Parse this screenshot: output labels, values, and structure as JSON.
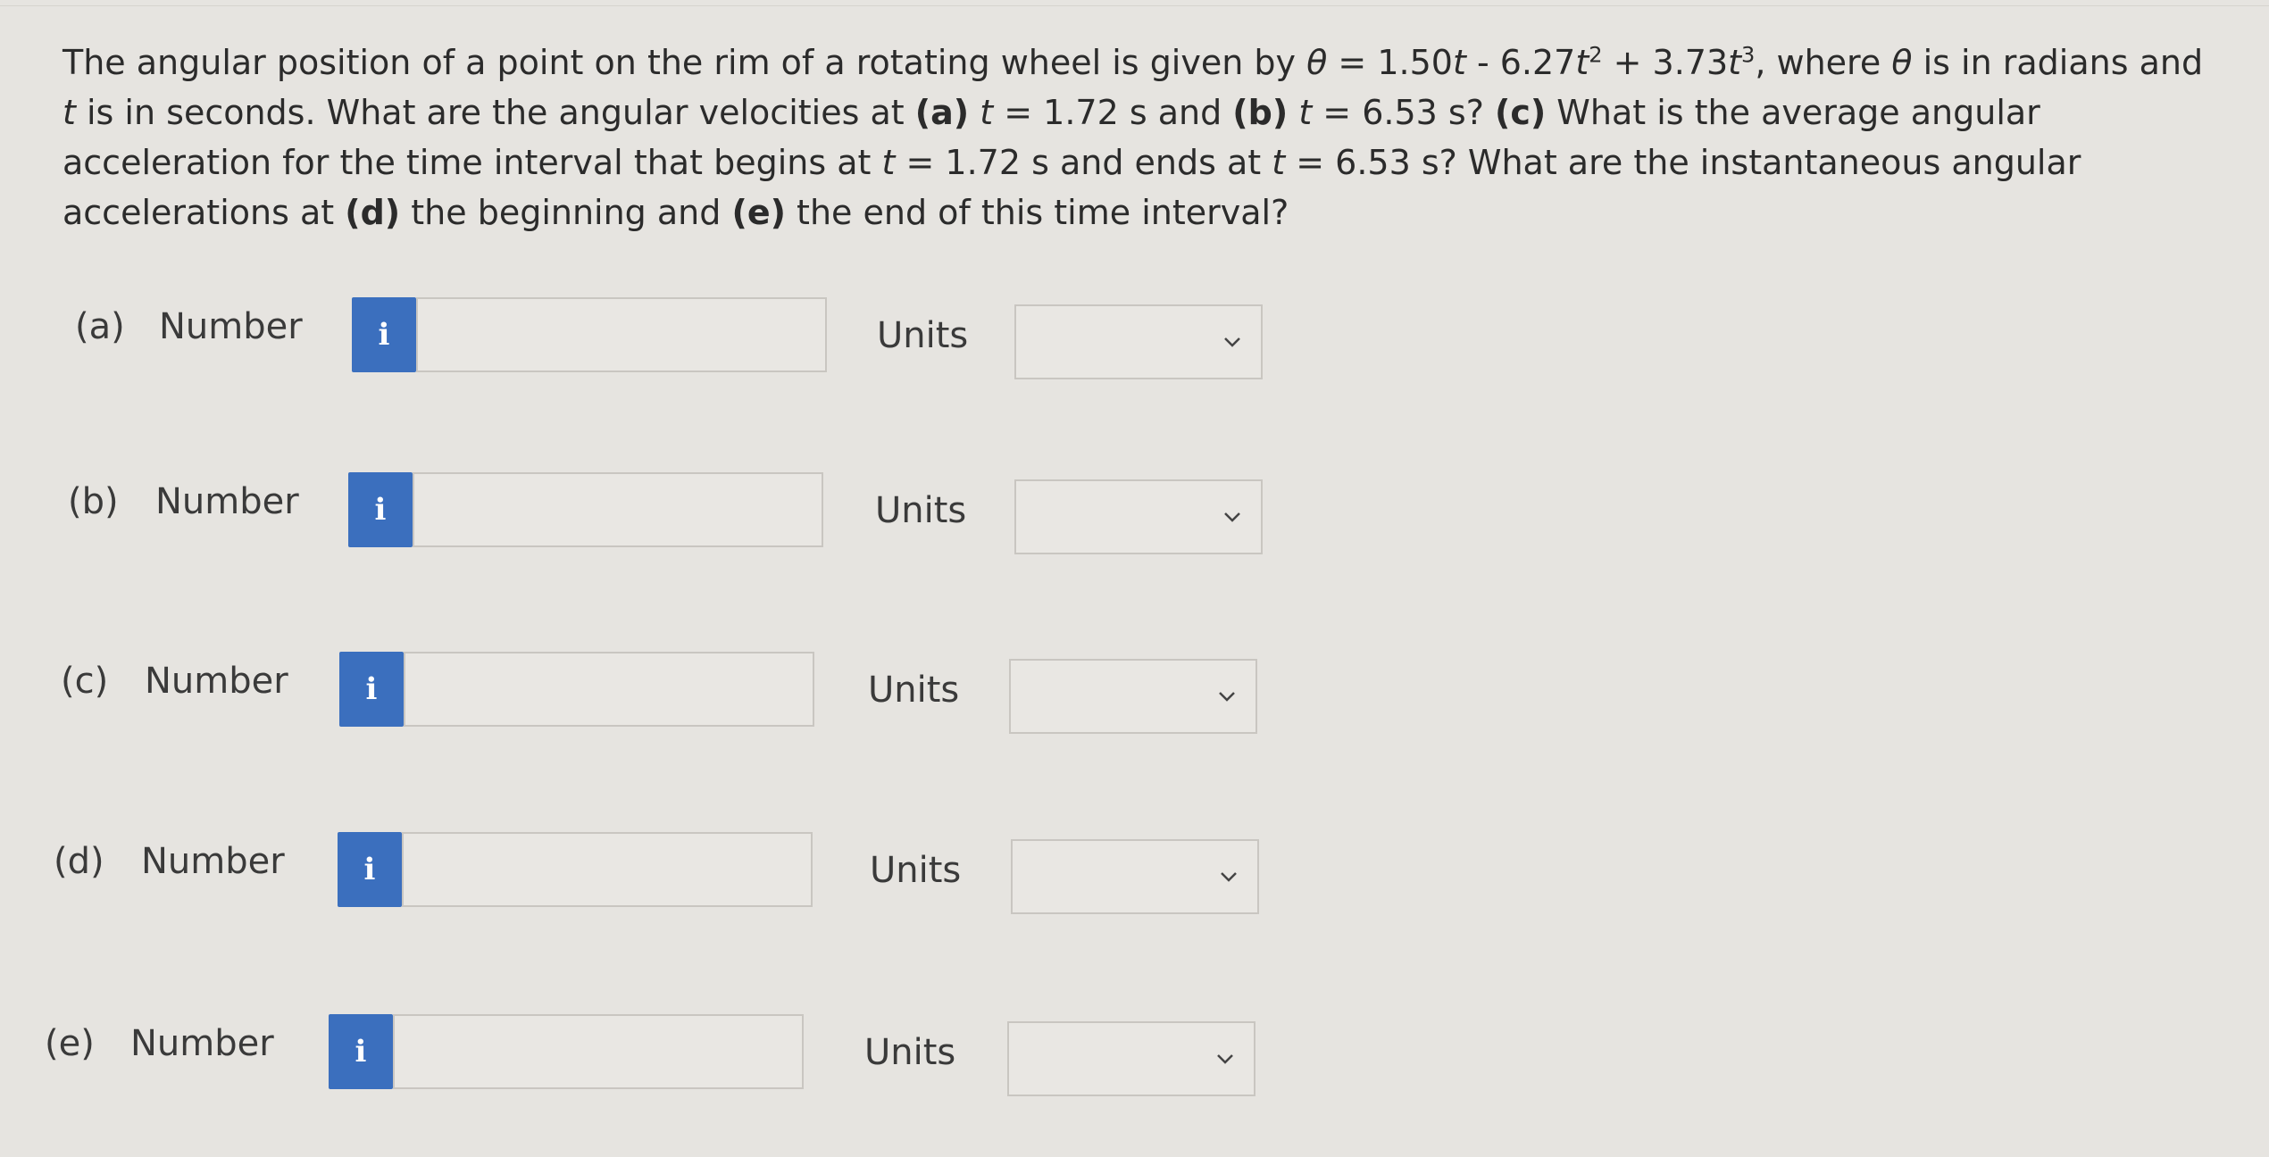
{
  "question": {
    "p1": "The angular position of a point on the rim of a rotating wheel is given by ",
    "theta": "θ",
    "eq1": " = 1.50",
    "t": "t",
    "eq2": " - 6.27",
    "sq": "2",
    "eq3": " + 3.73",
    "cube": "3",
    "p2": ", where ",
    "p3": " is in radians and ",
    "p4": " is in seconds. What are the angular velocities at ",
    "a_tag": "(a)",
    "p5": " = 1.72 s and ",
    "b_tag": "(b)",
    "p6": " = 6.53 s? ",
    "c_tag": "(c)",
    "p7": " What is the average angular acceleration for the time interval that begins at ",
    "p8": " = 1.72 s and ends at ",
    "p9": " = 6.53 s? What are the instantaneous angular accelerations at ",
    "d_tag": "(d)",
    "p10": " the beginning and ",
    "e_tag": "(e)",
    "p11": " the end of this time interval?"
  },
  "parts": [
    {
      "tag": "(a)",
      "number_label": "Number",
      "info": "i",
      "value": "",
      "units_label": "Units",
      "units_value": ""
    },
    {
      "tag": "(b)",
      "number_label": "Number",
      "info": "i",
      "value": "",
      "units_label": "Units",
      "units_value": ""
    },
    {
      "tag": "(c)",
      "number_label": "Number",
      "info": "i",
      "value": "",
      "units_label": "Units",
      "units_value": ""
    },
    {
      "tag": "(d)",
      "number_label": "Number",
      "info": "i",
      "value": "",
      "units_label": "Units",
      "units_value": ""
    },
    {
      "tag": "(e)",
      "number_label": "Number",
      "info": "i",
      "value": "",
      "units_label": "Units",
      "units_value": ""
    }
  ],
  "colors": {
    "background": "#e6e4e0",
    "info_button": "#3b6fbe",
    "field_border": "#c9c6c1"
  }
}
